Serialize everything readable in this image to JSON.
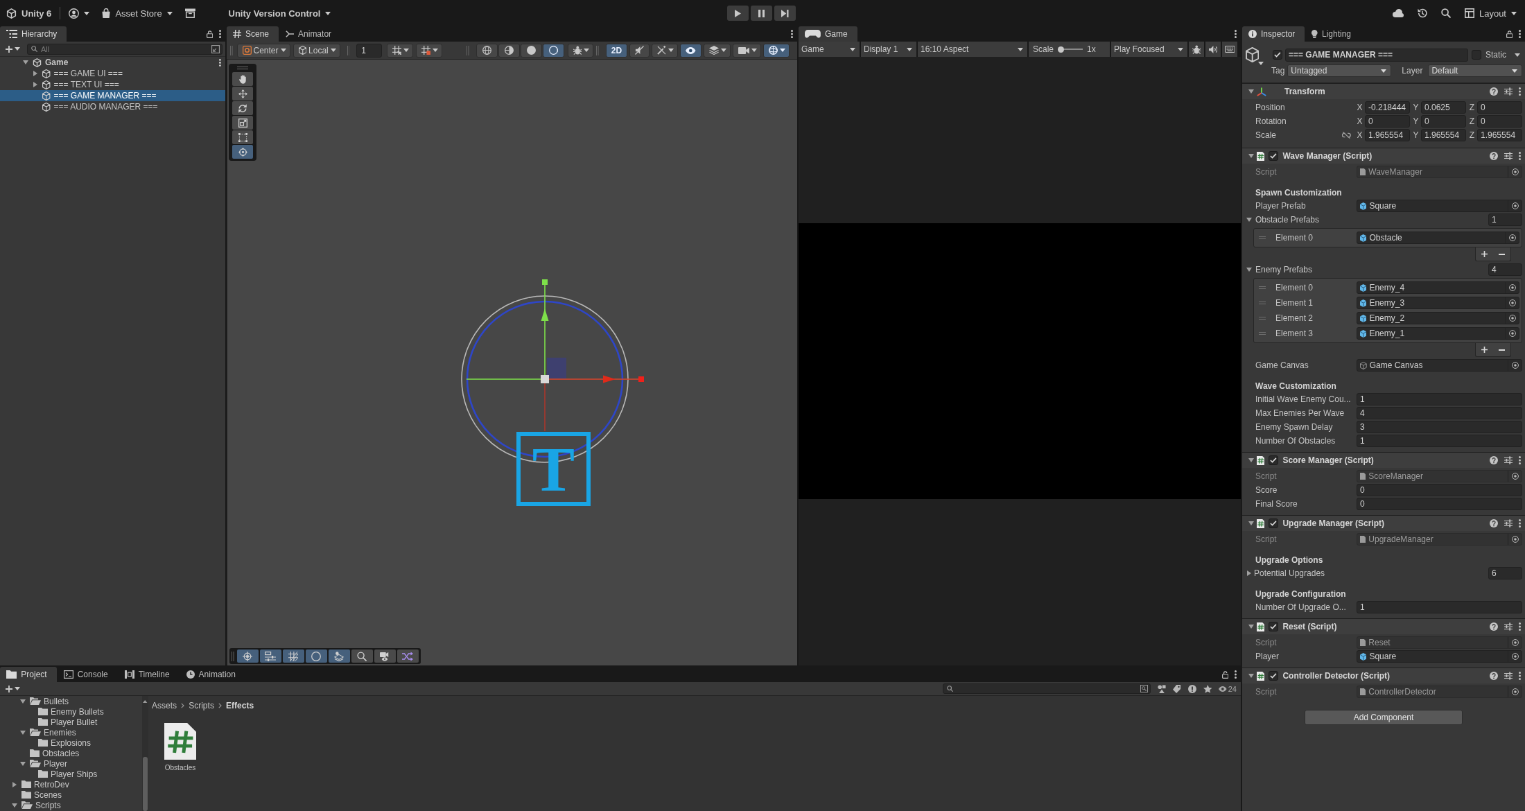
{
  "toolbar": {
    "product": "Unity 6",
    "asset_store": "Asset Store",
    "version_control": "Unity Version Control",
    "playback": [
      {
        "kind": "play",
        "selected": false
      },
      {
        "kind": "pause",
        "selected": false
      },
      {
        "kind": "step",
        "selected": false
      }
    ],
    "layout": "Layout"
  },
  "hierarchy": {
    "tab": "Hierarchy",
    "search": {
      "placeholder": "All"
    },
    "scene": {
      "name": "Game",
      "expandable": true,
      "expanded": true,
      "children": [
        {
          "name": "=== GAME UI ===",
          "expandable": true,
          "expanded": false,
          "selected": false
        },
        {
          "name": "=== TEXT UI ===",
          "expandable": true,
          "expanded": false,
          "selected": false
        },
        {
          "name": "=== GAME MANAGER ===",
          "expandable": false,
          "selected": true
        },
        {
          "name": "=== AUDIO MANAGER ===",
          "expandable": false,
          "selected": false
        }
      ]
    }
  },
  "scene_view": {
    "tabs": [
      {
        "label": "Scene",
        "kind": "scene",
        "selected": true
      },
      {
        "label": "Animator",
        "kind": "animator",
        "selected": false
      }
    ],
    "pivot_mode": "Center",
    "pivot_space": "Local",
    "snap_increment": "1",
    "toolbar_groups": [
      [
        {
          "kind": "gridsnap",
          "selected": false,
          "dropdown": true
        },
        {
          "kind": "incrementsnap",
          "selected": false,
          "dropdown": true
        }
      ],
      [
        {
          "kind": "wireframe",
          "selected": false,
          "dropdown": false
        },
        {
          "kind": "shadedwireframe",
          "selected": false,
          "dropdown": false
        },
        {
          "kind": "shaded",
          "selected": false,
          "dropdown": false
        },
        {
          "kind": "lighting",
          "selected": true,
          "dropdown": false
        }
      ],
      [
        {
          "kind": "debug",
          "selected": false,
          "dropdown": true
        }
      ],
      [
        {
          "kind": "planar",
          "label": "2D",
          "selected": true,
          "dropdown": false
        },
        {
          "kind": "audio",
          "selected": false,
          "dropdown": false
        },
        {
          "kind": "effects",
          "selected": false,
          "dropdown": true
        },
        {
          "kind": "visibility",
          "selected": true,
          "dropdown": false
        },
        {
          "kind": "layers",
          "selected": false,
          "dropdown": true
        },
        {
          "kind": "camera",
          "selected": false,
          "dropdown": true
        },
        {
          "kind": "gizmos",
          "selected": true,
          "dropdown": true
        }
      ]
    ],
    "tools": [
      {
        "kind": "hand",
        "selected": false
      },
      {
        "kind": "move",
        "selected": false
      },
      {
        "kind": "rotate",
        "selected": false
      },
      {
        "kind": "scale",
        "selected": false
      },
      {
        "kind": "rect",
        "selected": false
      },
      {
        "kind": "transform",
        "selected": true
      }
    ],
    "text_gizmo": "T",
    "overlay_buttons": [
      {
        "kind": "crosshair",
        "selected": true
      },
      {
        "kind": "sliders",
        "selected": true
      },
      {
        "kind": "hatch",
        "selected": true
      },
      {
        "kind": "crescent",
        "selected": true
      },
      {
        "kind": "diamonds",
        "selected": true
      },
      {
        "kind": "magnifier",
        "selected": false
      },
      {
        "kind": "cameraeye",
        "selected": false
      },
      {
        "kind": "shuffle",
        "selected": false
      }
    ]
  },
  "game_view": {
    "tab": "Game",
    "mode": "Game",
    "display": "Display 1",
    "aspect": "16:10 Aspect",
    "scale_label": "Scale",
    "scale": {
      "level": 0
    },
    "scale_value": "1x",
    "play_mode": "Play Focused"
  },
  "inspector": {
    "tabs": [
      {
        "label": "Inspector",
        "kind": "inspector",
        "selected": true
      },
      {
        "label": "Lighting",
        "kind": "lighting",
        "selected": false
      }
    ],
    "object": {
      "active": true,
      "name": "=== GAME MANAGER ===",
      "static": false,
      "static_label": "Static",
      "tag_label": "Tag",
      "tag": "Untagged",
      "layer_label": "Layer",
      "layer": "Default"
    },
    "components": [
      {
        "kind": "transform",
        "title": "Transform",
        "expanded": true,
        "rows": [
          {
            "label": "Position",
            "values": [
              {
                "axis": "X",
                "value": "-0.218444"
              },
              {
                "axis": "Y",
                "value": "0.0625"
              },
              {
                "axis": "Z",
                "value": "0"
              }
            ]
          },
          {
            "label": "Rotation",
            "values": [
              {
                "axis": "X",
                "value": "0"
              },
              {
                "axis": "Y",
                "value": "0"
              },
              {
                "axis": "Z",
                "value": "0"
              }
            ]
          },
          {
            "label": "Scale",
            "constrain_proportions": false,
            "values": [
              {
                "axis": "X",
                "value": "1.965554"
              },
              {
                "axis": "Y",
                "value": "1.965554"
              },
              {
                "axis": "Z",
                "value": "1.965554"
              }
            ]
          }
        ]
      },
      {
        "kind": "script",
        "title": "Wave Manager (Script)",
        "enabled": true,
        "expanded": true,
        "fields": [
          {
            "kind": "script",
            "label": "Script",
            "value": "WaveManager"
          },
          {
            "kind": "header",
            "label": "Spawn Customization"
          },
          {
            "kind": "prefab",
            "label": "Player Prefab",
            "value": "Square"
          },
          {
            "kind": "list",
            "label": "Obstacle Prefabs",
            "count": "1",
            "expanded": true,
            "items": [
              {
                "kind": "prefab",
                "label": "Element 0",
                "value": "Obstacle"
              }
            ]
          },
          {
            "kind": "list",
            "label": "Enemy Prefabs",
            "count": "4",
            "expanded": true,
            "items": [
              {
                "kind": "prefab",
                "label": "Element 0",
                "value": "Enemy_4"
              },
              {
                "kind": "prefab",
                "label": "Element 1",
                "value": "Enemy_3"
              },
              {
                "kind": "prefab",
                "label": "Element 2",
                "value": "Enemy_2"
              },
              {
                "kind": "prefab",
                "label": "Element 3",
                "value": "Enemy_1"
              }
            ]
          },
          {
            "kind": "gameobject",
            "label": "Game Canvas",
            "value": "Game Canvas"
          },
          {
            "kind": "header",
            "label": "Wave Customization"
          },
          {
            "kind": "number",
            "label": "Initial Wave Enemy Cou...",
            "value": "1"
          },
          {
            "kind": "number",
            "label": "Max Enemies Per Wave",
            "value": "4"
          },
          {
            "kind": "number",
            "label": "Enemy Spawn Delay",
            "value": "3"
          },
          {
            "kind": "number",
            "label": "Number Of Obstacles",
            "value": "1"
          }
        ]
      },
      {
        "kind": "script",
        "title": "Score Manager (Script)",
        "enabled": true,
        "expanded": true,
        "fields": [
          {
            "kind": "script",
            "label": "Script",
            "value": "ScoreManager"
          },
          {
            "kind": "number",
            "label": "Score",
            "value": "0"
          },
          {
            "kind": "number",
            "label": "Final Score",
            "value": "0"
          }
        ]
      },
      {
        "kind": "script",
        "title": "Upgrade Manager (Script)",
        "enabled": true,
        "expanded": true,
        "fields": [
          {
            "kind": "script",
            "label": "Script",
            "value": "UpgradeManager"
          },
          {
            "kind": "header",
            "label": "Upgrade Options"
          },
          {
            "kind": "list",
            "label": "Potential Upgrades",
            "count": "6",
            "expanded": false
          },
          {
            "kind": "header",
            "label": "Upgrade Configuration"
          },
          {
            "kind": "number",
            "label": "Number Of Upgrade O...",
            "value": "1"
          }
        ]
      },
      {
        "kind": "script",
        "title": "Reset (Script)",
        "enabled": true,
        "expanded": true,
        "fields": [
          {
            "kind": "script",
            "label": "Script",
            "value": "Reset"
          },
          {
            "kind": "prefab",
            "label": "Player",
            "value": "Square"
          }
        ]
      },
      {
        "kind": "script",
        "title": "Controller Detector (Script)",
        "enabled": true,
        "expanded": true,
        "fields": [
          {
            "kind": "script",
            "label": "Script",
            "value": "ControllerDetector"
          }
        ]
      }
    ],
    "add_component": "Add Component"
  },
  "project": {
    "tabs": [
      {
        "label": "Project",
        "kind": "project",
        "selected": true
      },
      {
        "label": "Console",
        "kind": "console",
        "selected": false
      },
      {
        "label": "Timeline",
        "kind": "timeline",
        "selected": false
      },
      {
        "label": "Animation",
        "kind": "animation",
        "selected": false
      }
    ],
    "hidden_count": "24",
    "folders": [
      {
        "children": [
          {
            "name": "Bullets",
            "expandable": true,
            "expanded": true,
            "children": [
              {
                "name": "Enemy Bullets",
                "expandable": false
              },
              {
                "name": "Player Bullet",
                "expandable": false
              }
            ]
          },
          {
            "name": "Enemies",
            "expandable": true,
            "expanded": true,
            "children": [
              {
                "name": "Explosions",
                "expandable": false
              }
            ]
          },
          {
            "name": "Obstacles",
            "expandable": false
          },
          {
            "name": "Player",
            "expandable": true,
            "expanded": true,
            "children": [
              {
                "name": "Player Ships",
                "expandable": false
              }
            ]
          }
        ]
      },
      {
        "name": "RetroDev",
        "expandable": true,
        "expanded": false
      },
      {
        "name": "Scenes",
        "expandable": false
      },
      {
        "name": "Scripts",
        "expandable": true,
        "expanded": true
      }
    ],
    "breadcrumb": [
      "Assets",
      "Scripts",
      "Effects"
    ],
    "assets": [
      {
        "name": "Obstacles",
        "kind": "script"
      }
    ]
  }
}
